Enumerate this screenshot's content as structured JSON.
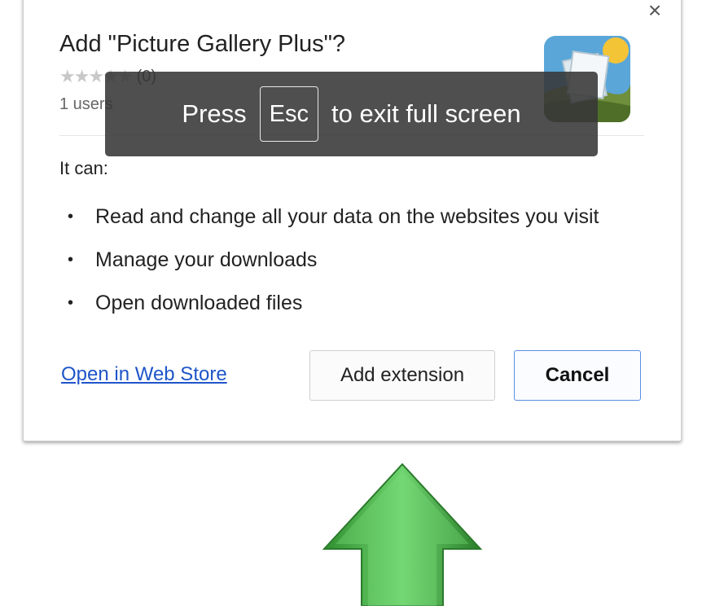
{
  "dialog": {
    "close_glyph": "×",
    "title": "Add \"Picture Gallery Plus\"?",
    "rating": {
      "stars": "★★★★★",
      "count": "(0)",
      "value": 0,
      "max": 5
    },
    "users_text": "1 users",
    "intro": "It can:",
    "permissions": [
      "Read and change all your data on the websites you visit",
      "Manage your downloads",
      "Open downloaded files"
    ],
    "bullet": "•",
    "links": {
      "web_store": "Open in Web Store"
    },
    "buttons": {
      "add": "Add extension",
      "cancel": "Cancel"
    },
    "icon_name": "picture-gallery-extension-icon"
  },
  "fullscreen_toast": {
    "press": "Press",
    "key": "Esc",
    "rest": "to exit full screen"
  },
  "pointer_arrow": {
    "icon_name": "green-up-arrow-icon",
    "color": "#3aa63a"
  },
  "colors": {
    "link": "#1e55c8",
    "cancel_border": "#5a8ee3",
    "toast_bg": "#373737"
  }
}
